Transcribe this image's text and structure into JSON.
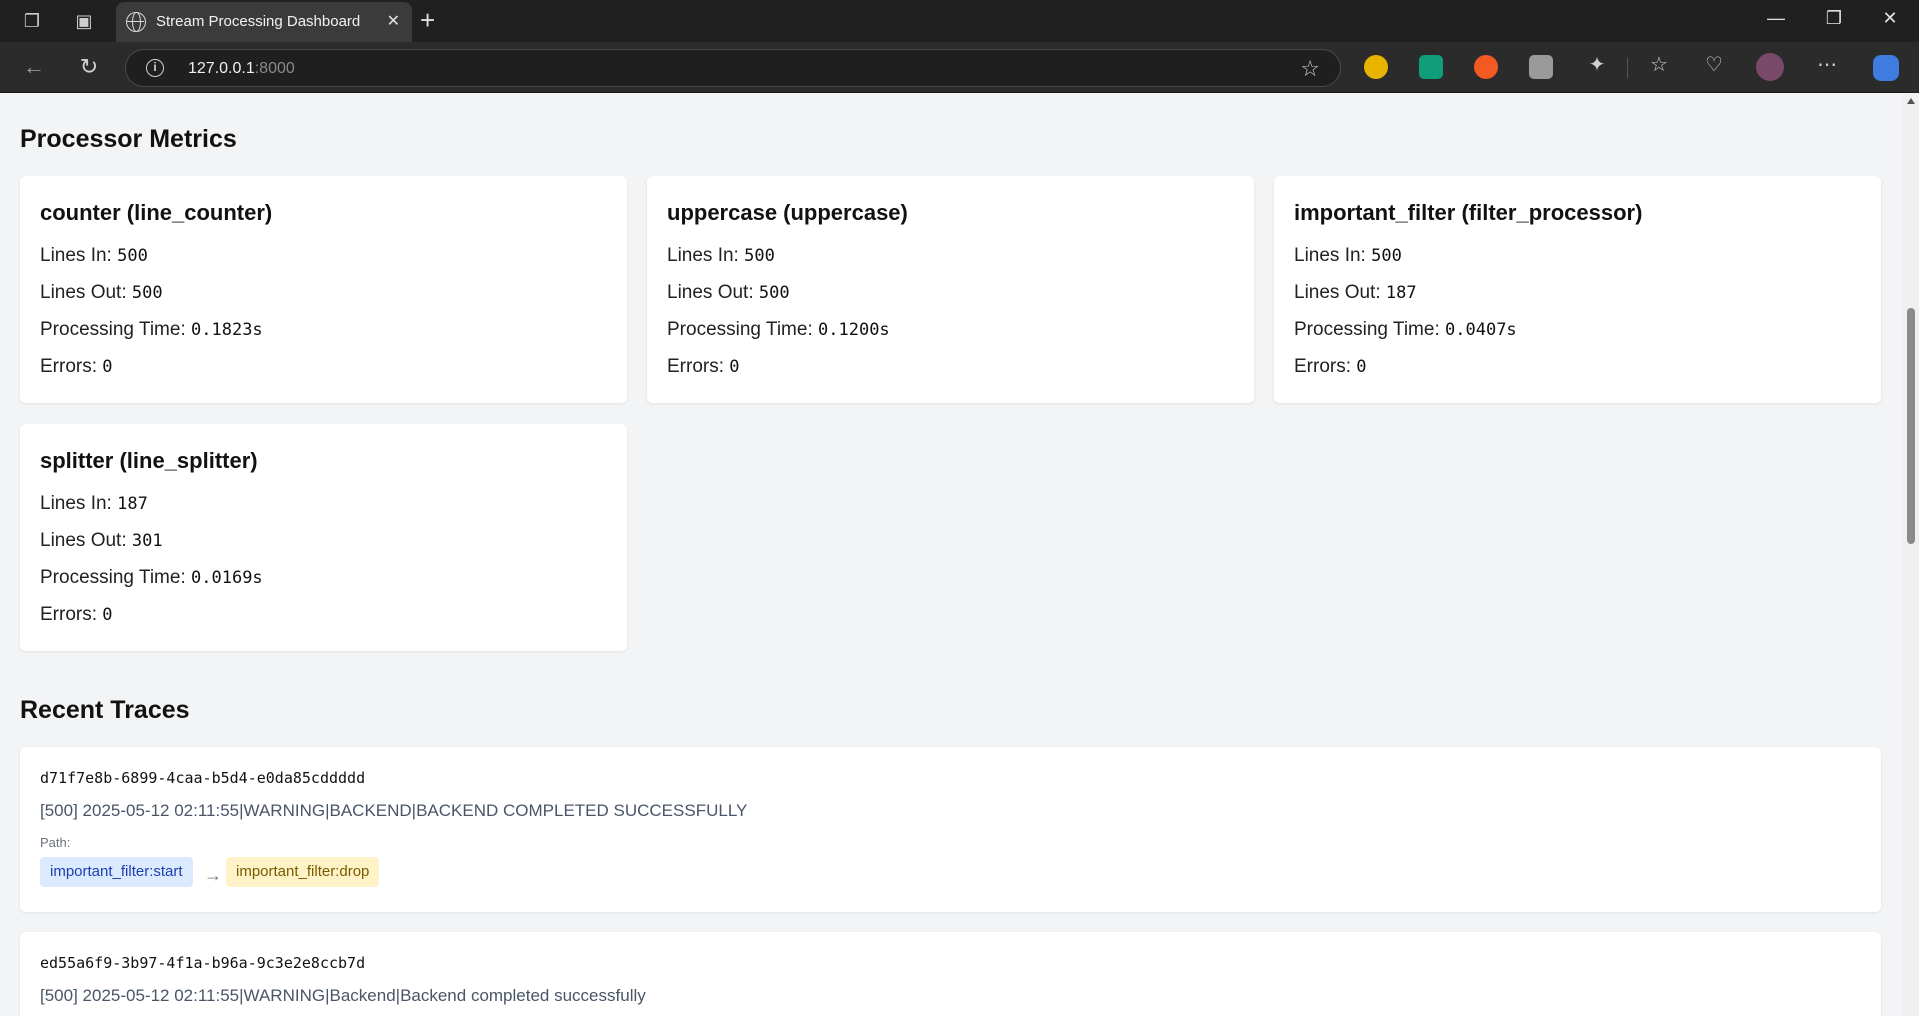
{
  "browser": {
    "tab_title": "Stream Processing Dashboard",
    "url_host": "127.0.0.1",
    "url_port": ":8000"
  },
  "sections": {
    "metrics_title": "Processor Metrics",
    "traces_title": "Recent Traces"
  },
  "labels": {
    "lines_in": "Lines In:",
    "lines_out": "Lines Out:",
    "processing_time": "Processing Time:",
    "errors": "Errors:",
    "path": "Path:"
  },
  "processors": [
    {
      "title": "counter (line_counter)",
      "lines_in": "500",
      "lines_out": "500",
      "processing_time": "0.1823s",
      "errors": "0"
    },
    {
      "title": "uppercase (uppercase)",
      "lines_in": "500",
      "lines_out": "500",
      "processing_time": "0.1200s",
      "errors": "0"
    },
    {
      "title": "important_filter (filter_processor)",
      "lines_in": "500",
      "lines_out": "187",
      "processing_time": "0.0407s",
      "errors": "0"
    },
    {
      "title": "splitter (line_splitter)",
      "lines_in": "187",
      "lines_out": "301",
      "processing_time": "0.0169s",
      "errors": "0"
    }
  ],
  "traces": [
    {
      "id": "d71f7e8b-6899-4caa-b5d4-e0da85cddddd",
      "message": "[500] 2025-05-12 02:11:55|WARNING|BACKEND|BACKEND COMPLETED SUCCESSFULLY",
      "path": [
        "important_filter:start",
        "important_filter:drop"
      ],
      "arrow": "→"
    },
    {
      "id": "ed55a6f9-3b97-4f1a-b96a-9c3e2e8ccb7d",
      "message": "[500] 2025-05-12 02:11:55|WARNING|Backend|Backend completed successfully"
    }
  ]
}
